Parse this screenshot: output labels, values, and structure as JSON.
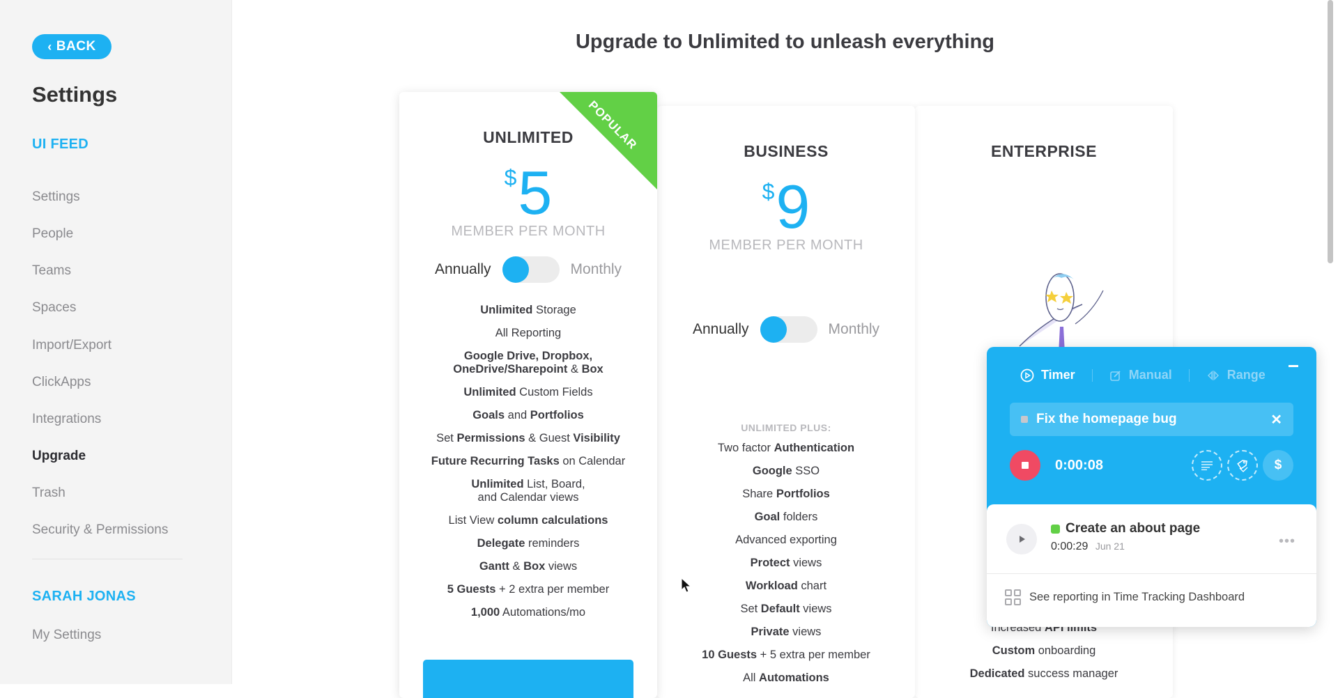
{
  "sidebar": {
    "back_label": "BACK",
    "title": "Settings",
    "workspace_section": "UI FEED",
    "items": [
      {
        "label": "Settings",
        "active": false
      },
      {
        "label": "People",
        "active": false
      },
      {
        "label": "Teams",
        "active": false
      },
      {
        "label": "Spaces",
        "active": false
      },
      {
        "label": "Import/Export",
        "active": false
      },
      {
        "label": "ClickApps",
        "active": false
      },
      {
        "label": "Integrations",
        "active": false
      },
      {
        "label": "Upgrade",
        "active": true
      },
      {
        "label": "Trash",
        "active": false
      },
      {
        "label": "Security & Permissions",
        "active": false
      }
    ],
    "user_section": "SARAH JONAS",
    "user_items": [
      {
        "label": "My Settings"
      }
    ]
  },
  "main": {
    "title": "Upgrade to Unlimited to unleash everything"
  },
  "plans": [
    {
      "name": "UNLIMITED",
      "badge": "POPULAR",
      "currency": "$",
      "price": "5",
      "per": "MEMBER PER MONTH",
      "toggle": {
        "left": "Annually",
        "right": "Monthly",
        "selected": "Annually"
      },
      "features_heading": "",
      "features": [
        [
          [
            "b",
            "Unlimited"
          ],
          [
            "t",
            " Storage"
          ]
        ],
        [
          [
            "t",
            "All Reporting"
          ]
        ],
        [
          [
            "b",
            "Google Drive, Dropbox,"
          ],
          [
            "br",
            ""
          ],
          [
            "b",
            "OneDrive/Sharepoint"
          ],
          [
            "t",
            " & "
          ],
          [
            "b",
            "Box"
          ]
        ],
        [
          [
            "b",
            "Unlimited"
          ],
          [
            "t",
            " Custom Fields"
          ]
        ],
        [
          [
            "b",
            "Goals"
          ],
          [
            "t",
            " and "
          ],
          [
            "b",
            "Portfolios"
          ]
        ],
        [
          [
            "t",
            "Set "
          ],
          [
            "b",
            "Permissions"
          ],
          [
            "t",
            " & Guest "
          ],
          [
            "b",
            "Visibility"
          ]
        ],
        [
          [
            "b",
            "Future Recurring Tasks"
          ],
          [
            "t",
            " on Calendar"
          ]
        ],
        [
          [
            "b",
            "Unlimited"
          ],
          [
            "t",
            " List, Board,"
          ],
          [
            "br",
            ""
          ],
          [
            "t",
            "and Calendar views"
          ]
        ],
        [
          [
            "t",
            "List View "
          ],
          [
            "b",
            "column calculations"
          ]
        ],
        [
          [
            "b",
            "Delegate"
          ],
          [
            "t",
            " reminders"
          ]
        ],
        [
          [
            "b",
            "Gantt"
          ],
          [
            "t",
            " & "
          ],
          [
            "b",
            "Box"
          ],
          [
            "t",
            " views"
          ]
        ],
        [
          [
            "b",
            "5 Guests"
          ],
          [
            "t",
            " + 2 extra per member"
          ]
        ],
        [
          [
            "b",
            "1,000"
          ],
          [
            "t",
            " Automations/mo"
          ]
        ]
      ]
    },
    {
      "name": "BUSINESS",
      "currency": "$",
      "price": "9",
      "per": "MEMBER PER MONTH",
      "toggle": {
        "left": "Annually",
        "right": "Monthly",
        "selected": "Annually"
      },
      "features_heading": "UNLIMITED PLUS:",
      "features": [
        [
          [
            "t",
            "Two factor "
          ],
          [
            "b",
            "Authentication"
          ]
        ],
        [
          [
            "b",
            "Google"
          ],
          [
            "t",
            " SSO"
          ]
        ],
        [
          [
            "t",
            "Share "
          ],
          [
            "b",
            "Portfolios"
          ]
        ],
        [
          [
            "b",
            "Goal"
          ],
          [
            "t",
            " folders"
          ]
        ],
        [
          [
            "t",
            "Advanced exporting"
          ]
        ],
        [
          [
            "b",
            "Protect"
          ],
          [
            "t",
            " views"
          ]
        ],
        [
          [
            "b",
            "Workload"
          ],
          [
            "t",
            " chart"
          ]
        ],
        [
          [
            "t",
            "Set "
          ],
          [
            "b",
            "Default"
          ],
          [
            "t",
            " views"
          ]
        ],
        [
          [
            "b",
            "Private"
          ],
          [
            "t",
            " views"
          ]
        ],
        [
          [
            "b",
            "10 Guests"
          ],
          [
            "t",
            " + 5 extra per member"
          ]
        ],
        [
          [
            "t",
            "All "
          ],
          [
            "b",
            "Automations"
          ]
        ]
      ]
    },
    {
      "name": "ENTERPRISE",
      "features": [
        [
          [
            "t",
            "Increased "
          ],
          [
            "b",
            "API limits"
          ]
        ],
        [
          [
            "b",
            "Custom"
          ],
          [
            "t",
            " onboarding"
          ]
        ],
        [
          [
            "b",
            "Dedicated"
          ],
          [
            "t",
            " success manager"
          ]
        ]
      ]
    }
  ],
  "timer": {
    "tabs": [
      {
        "label": "Timer",
        "icon": "play-circle-icon",
        "active": true
      },
      {
        "label": "Manual",
        "icon": "edit-icon",
        "active": false
      },
      {
        "label": "Range",
        "icon": "range-icon",
        "active": false
      }
    ],
    "current_task": "Fix the homepage bug",
    "elapsed": "0:00:08",
    "actions": [
      {
        "icon": "notes-icon"
      },
      {
        "icon": "tag-icon"
      },
      {
        "icon": "billable-icon",
        "glyph": "$"
      }
    ],
    "recent": {
      "title": "Create an about page",
      "status_color": "#62d046",
      "duration": "0:00:29",
      "date": "Jun 21",
      "more": "•••"
    },
    "report_link": "See reporting in Time Tracking Dashboard"
  },
  "colors": {
    "accent": "#1db1f2",
    "popular": "#62d046",
    "stop": "#f04a63"
  }
}
